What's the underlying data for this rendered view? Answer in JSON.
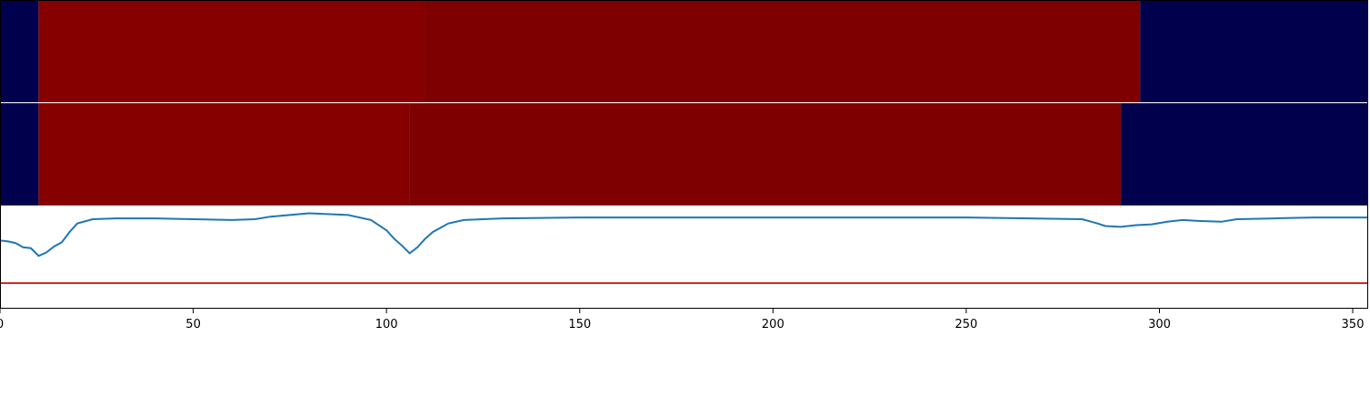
{
  "chart_data": {
    "type": "heatmap",
    "x_axis": {
      "range": [
        0,
        354
      ],
      "ticks": [
        0,
        50,
        100,
        150,
        200,
        250,
        300,
        350
      ],
      "tick_labels": [
        "0",
        "50",
        "100",
        "150",
        "200",
        "250",
        "300",
        "350"
      ]
    },
    "colors": {
      "low": "#00004c",
      "high_light": "#870000",
      "high_dark": "#7f0000",
      "trace": "#1f77b4",
      "threshold": "#d62728"
    },
    "bands": [
      {
        "segments": [
          {
            "x0": 0,
            "x1": 10,
            "level": "low"
          },
          {
            "x0": 10,
            "x1": 110,
            "level": "high_light"
          },
          {
            "x0": 110,
            "x1": 295,
            "level": "high_dark"
          },
          {
            "x0": 295,
            "x1": 354,
            "level": "low"
          }
        ]
      },
      {
        "segments": [
          {
            "x0": 0,
            "x1": 10,
            "level": "low"
          },
          {
            "x0": 10,
            "x1": 106,
            "level": "high_light"
          },
          {
            "x0": 106,
            "x1": 290,
            "level": "high_dark"
          },
          {
            "x0": 290,
            "x1": 354,
            "level": "low"
          }
        ]
      }
    ],
    "line_plot": {
      "ylim": [
        0,
        1.2
      ],
      "threshold": 0.3,
      "series": {
        "x": [
          0,
          2,
          4,
          6,
          8,
          10,
          12,
          14,
          16,
          18,
          20,
          24,
          30,
          40,
          60,
          66,
          70,
          80,
          90,
          96,
          98,
          100,
          102,
          104,
          106,
          108,
          110,
          112,
          114,
          116,
          120,
          130,
          150,
          200,
          250,
          280,
          284,
          286,
          290,
          294,
          298,
          302,
          306,
          310,
          316,
          320,
          330,
          340,
          350,
          354
        ],
        "y": [
          0.8,
          0.79,
          0.77,
          0.72,
          0.71,
          0.62,
          0.66,
          0.73,
          0.78,
          0.9,
          1.0,
          1.05,
          1.06,
          1.06,
          1.04,
          1.05,
          1.08,
          1.12,
          1.1,
          1.04,
          0.98,
          0.92,
          0.82,
          0.74,
          0.65,
          0.72,
          0.82,
          0.9,
          0.95,
          1.0,
          1.04,
          1.06,
          1.07,
          1.07,
          1.07,
          1.05,
          1.0,
          0.97,
          0.96,
          0.98,
          0.99,
          1.02,
          1.04,
          1.03,
          1.02,
          1.05,
          1.06,
          1.07,
          1.07,
          1.07
        ]
      }
    }
  }
}
